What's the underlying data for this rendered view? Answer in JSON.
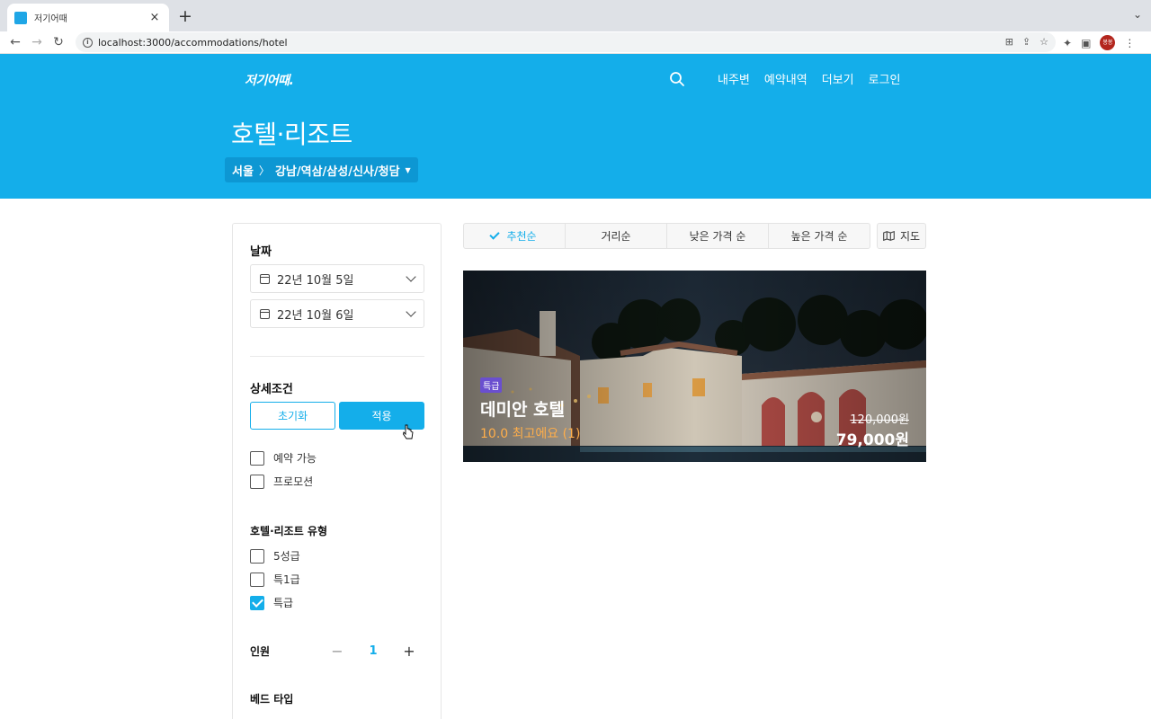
{
  "browser": {
    "tab_title": "저기어때",
    "tab_close": "×",
    "new_tab": "+",
    "url": "localhost:3000/accommodations/hotel",
    "profile_initials": "봉봉"
  },
  "header": {
    "logo": "저기어때.",
    "nav": [
      "내주변",
      "예약내역",
      "더보기",
      "로그인"
    ],
    "title": "호텔·리조트",
    "breadcrumb_city": "서울",
    "breadcrumb_area": "강남/역삼/삼성/신사/청담"
  },
  "filters": {
    "date_heading": "날짜",
    "checkin": "22년 10월 5일",
    "checkout": "22년 10월 6일",
    "detail_heading": "상세조건",
    "reset_label": "초기화",
    "apply_label": "적용",
    "availability": [
      {
        "label": "예약 가능",
        "checked": false
      },
      {
        "label": "프로모션",
        "checked": false
      }
    ],
    "type_heading": "호텔·리조트 유형",
    "types": [
      {
        "label": "5성급",
        "checked": false
      },
      {
        "label": "특1급",
        "checked": false
      },
      {
        "label": "특급",
        "checked": true
      }
    ],
    "guests_heading": "인원",
    "guests_value": "1",
    "minus": "−",
    "plus": "+",
    "bed_heading": "베드 타입"
  },
  "sort": {
    "options": [
      "추천순",
      "거리순",
      "낮은 가격 순",
      "높은 가격 순"
    ],
    "active_index": 0,
    "map_label": "지도"
  },
  "hotel": {
    "badge": "특급",
    "name": "데미안 호텔",
    "rating": "10.0 최고에요 (1)",
    "original_price": "120,000원",
    "price": "79,000원"
  },
  "colors": {
    "brand": "#14aeea",
    "badge": "#6a4fcf",
    "rating": "#ffae4a"
  }
}
